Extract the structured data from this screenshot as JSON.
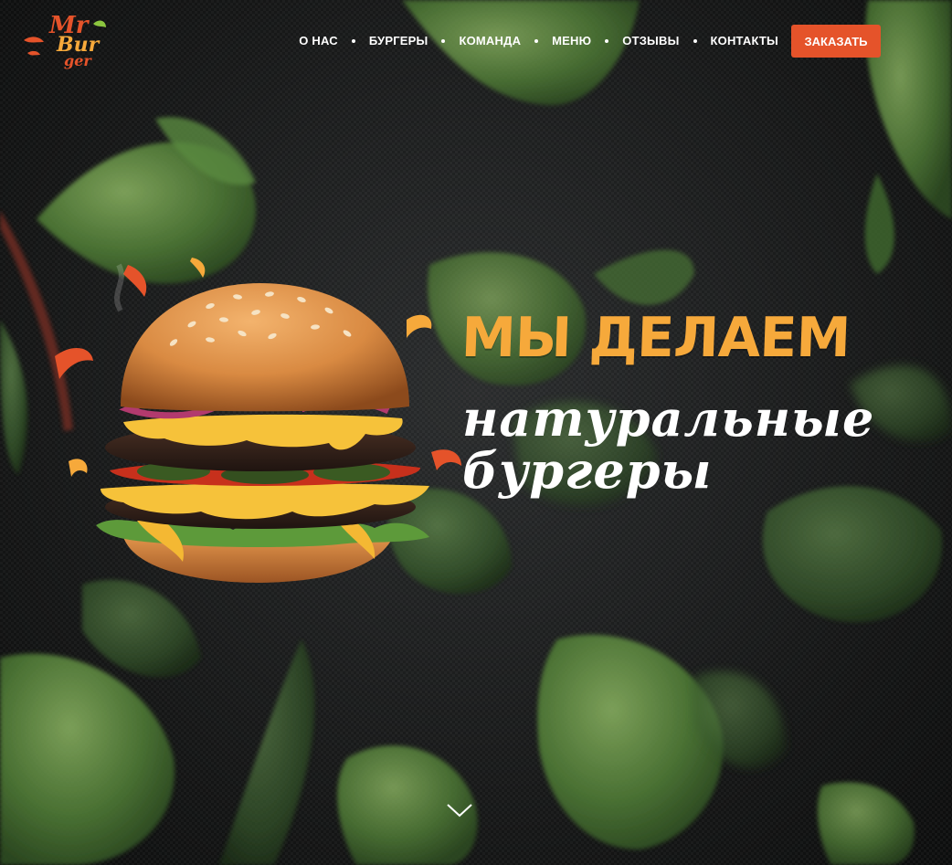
{
  "header": {
    "logo": {
      "line1": "Mr",
      "line2": "Bur",
      "line3": "ger",
      "colors": {
        "red": "#e5532a",
        "orange": "#f6a93b",
        "green": "#8cc63f"
      }
    },
    "nav": [
      {
        "label": "О НАС"
      },
      {
        "label": "БУРГЕРЫ"
      },
      {
        "label": "КОМАНДА"
      },
      {
        "label": "МЕНЮ"
      },
      {
        "label": "ОТЗЫВЫ"
      },
      {
        "label": "КОНТАКТЫ"
      }
    ],
    "order_button": "ЗАКАЗАТЬ"
  },
  "hero": {
    "headline": "МЫ ДЕЛАЕМ",
    "subline_1": "натуральные",
    "subline_2": "бургеры",
    "image": "burger-image",
    "background": "flying-lettuce-leaves",
    "scroll_icon": "chevron-down-icon"
  },
  "colors": {
    "accent": "#e5532a",
    "headline": "#f6a93b",
    "text": "#ffffff",
    "background": "#151617"
  }
}
